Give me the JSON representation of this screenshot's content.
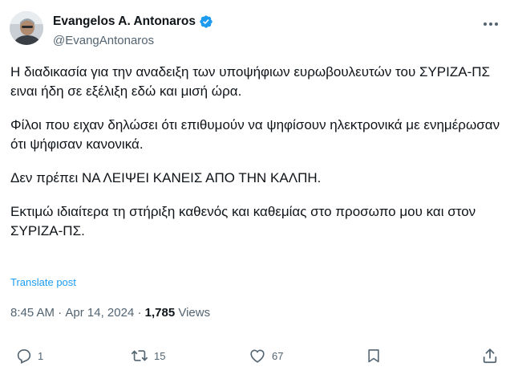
{
  "author": {
    "display_name": "Evangelos A. Antonaros",
    "handle": "@EvangAntonaros",
    "verified_color": "#1d9bf0"
  },
  "tweet": {
    "paragraphs": [
      "Η διαδικασία για την αναδειξη των υποψήφιων ευρωβουλευτών του ΣΥΡΙΖΑ-ΠΣ ειναι ήδη σε εξέλιξη εδώ και μισή ώρα.",
      "Φίλοι που  ειχαν δηλώσει ότι επιθυμούν να ψηφίσουν ηλεκτρονικά με ενημέρωσαν ότι ψήφισαν κανονικά.",
      "Δεν πρέπει ΝΑ ΛΕΙΨΕΙ ΚΑΝΕΙΣ ΑΠΟ ΤΗΝ ΚΑΛΠΗ.",
      "Εκτιμώ ιδιαίτερα τη στήριξη καθενός και καθεμίας στο προσωπο μου και στον ΣΥΡΙΖΑ-ΠΣ."
    ],
    "translate_label": "Translate post",
    "time": "8:45 AM",
    "separator": " · ",
    "date": "Apr 14, 2024",
    "views_count": "1,785",
    "views_label": " Views"
  },
  "actions": {
    "replies": "1",
    "reposts": "15",
    "likes": "67"
  },
  "icons": [
    "more-icon",
    "verified-icon",
    "reply-icon",
    "repost-icon",
    "like-icon",
    "bookmark-icon",
    "share-icon"
  ]
}
